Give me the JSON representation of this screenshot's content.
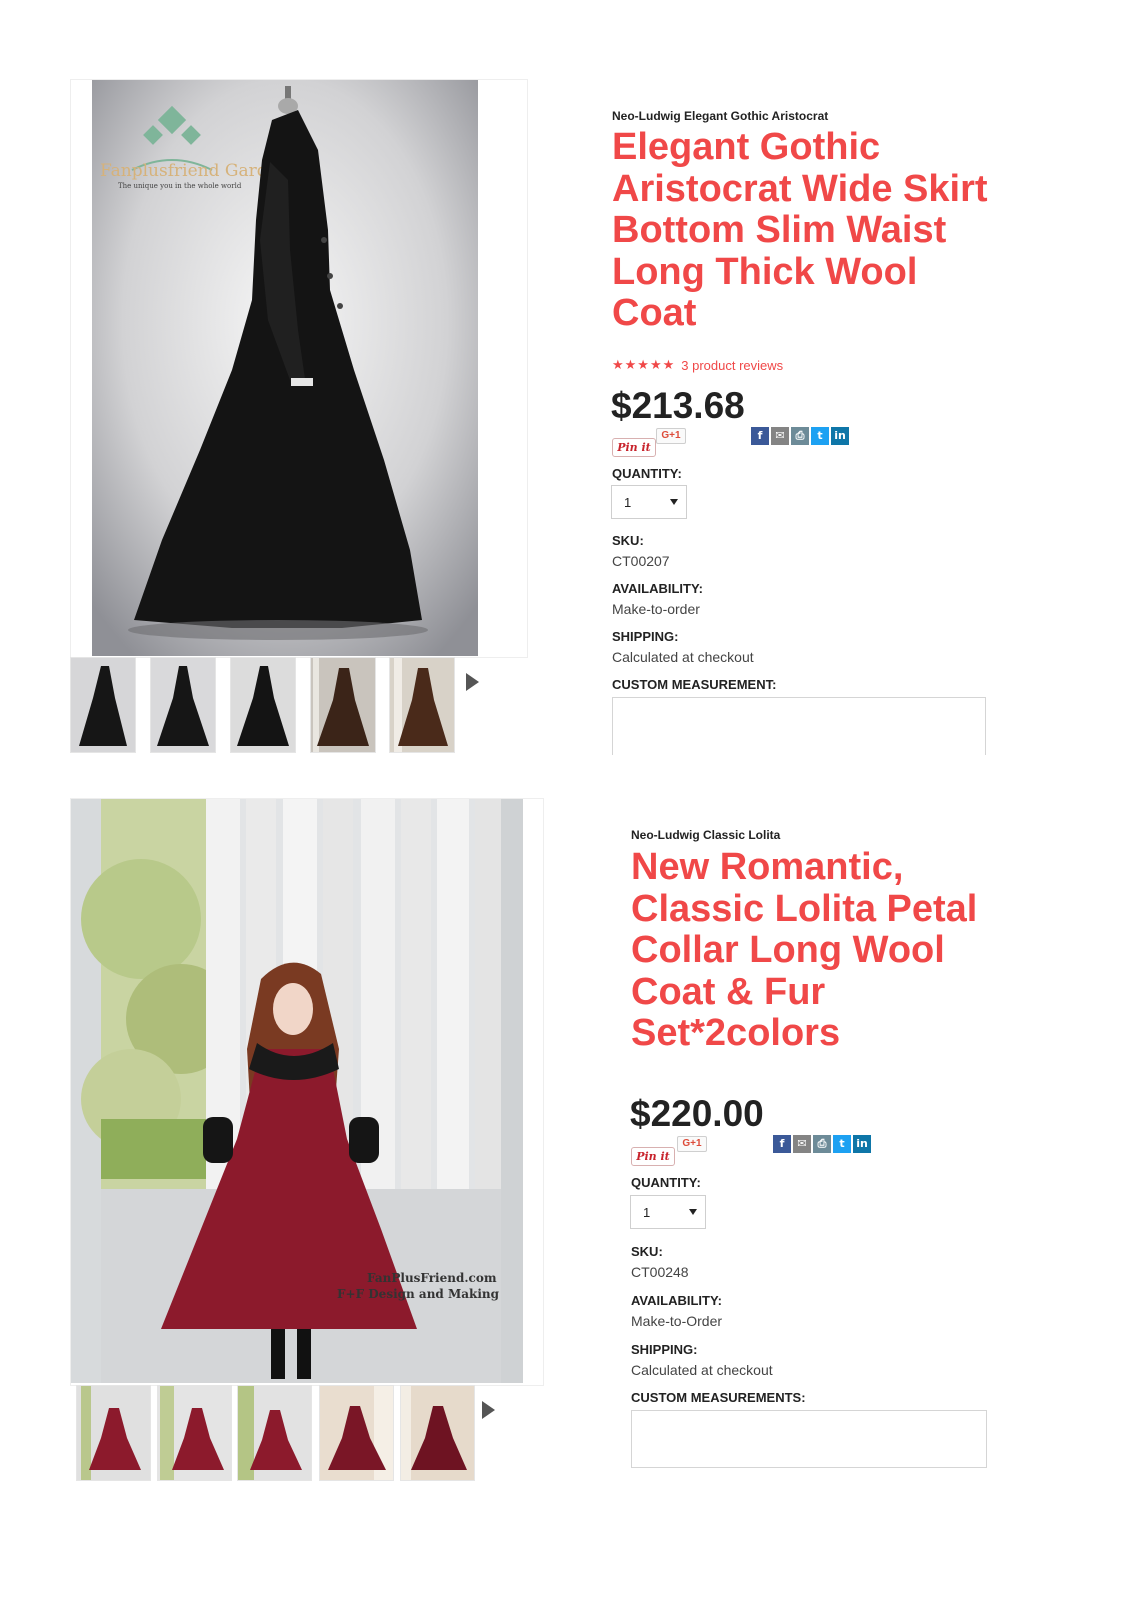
{
  "products": [
    {
      "brand": "Neo-Ludwig Elegant Gothic Aristocrat",
      "title_lines": [
        "Elegant Gothic",
        "Aristocrat Wide Skirt",
        "Bottom Slim Waist",
        "Long Thick Wool",
        "Coat"
      ],
      "rating_stars": "★★★★★",
      "reviews": "3 product reviews",
      "price": "$213.68",
      "pin_label": "Pin it",
      "gplus_label": "G+1",
      "quantity_label": "QUANTITY:",
      "quantity_value": "1",
      "sku_label": "SKU:",
      "sku": "CT00207",
      "availability_label": "AVAILABILITY:",
      "availability": "Make-to-order",
      "shipping_label": "SHIPPING:",
      "shipping": "Calculated at checkout",
      "custom_label": "CUSTOM MEASUREMENT:",
      "watermark_brand": "Fanplusfriend Garden",
      "watermark_tagline": "The unique you in the whole world",
      "garment_color": "#141414"
    },
    {
      "brand": "Neo-Ludwig Classic Lolita",
      "title_lines": [
        "New Romantic,",
        "Classic Lolita Petal",
        "Collar Long Wool",
        "Coat & Fur",
        "Set*2colors"
      ],
      "price": "$220.00",
      "pin_label": "Pin it",
      "gplus_label": "G+1",
      "quantity_label": "QUANTITY:",
      "quantity_value": "1",
      "sku_label": "SKU:",
      "sku": "CT00248",
      "availability_label": "AVAILABILITY:",
      "availability": "Make-to-Order",
      "shipping_label": "SHIPPING:",
      "shipping": "Calculated at checkout",
      "custom_label": "CUSTOM MEASUREMENTS:",
      "watermark_line1": "FanPlusFriend.com",
      "watermark_line2": "F+F Design and Making",
      "garment_color": "#8c1a2c"
    }
  ],
  "share_icons": [
    "facebook-icon",
    "email-icon",
    "print-icon",
    "twitter-icon",
    "linkedin-icon"
  ],
  "colors": {
    "title_red": "#f04848",
    "text_dark": "#222222"
  }
}
